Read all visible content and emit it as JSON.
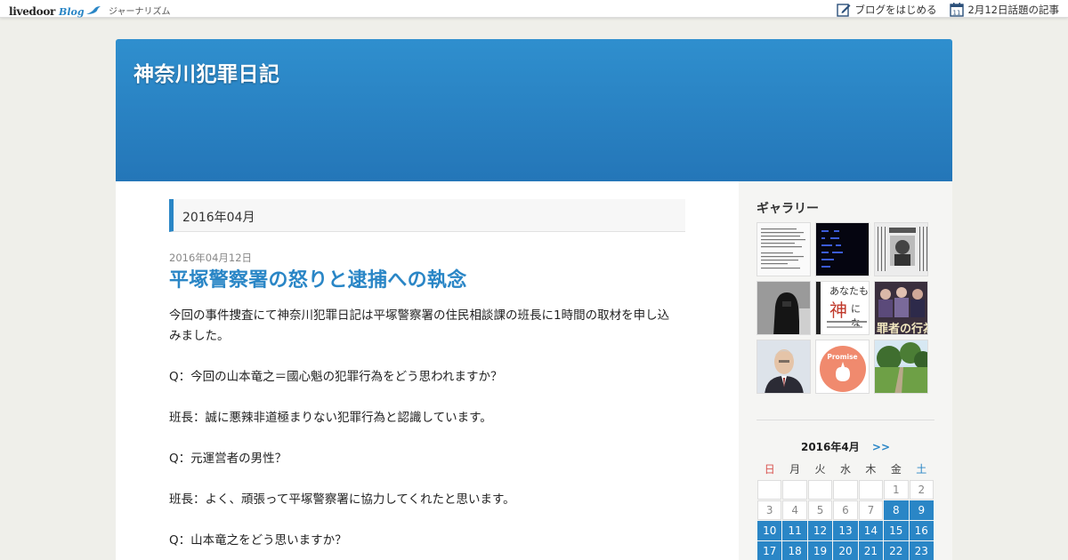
{
  "topbar": {
    "logo_main": "livedoor",
    "logo_blog": "Blog",
    "category": "ジャーナリズム",
    "start_blog": "ブログをはじめる",
    "topic_date_icon": "11",
    "topic_link": "2月12日話題の記事"
  },
  "header": {
    "site_title": "神奈川犯罪日記"
  },
  "archive": {
    "month_label": "2016年04月"
  },
  "post": {
    "date": "2016年04月12日",
    "title": "平塚警察署の怒りと逮捕への執念",
    "paragraphs": [
      "今回の事件捜査にて神奈川犯罪日記は平塚警察署の住民相談課の班長に1時間の取材を申し込みました。",
      "Q：今回の山本竜之＝國心魁の犯罪行為をどう思われますか？",
      "班長：誠に悪辣非道極まりない犯罪行為と認識しています。",
      "Q：元運営者の男性？",
      "班長：よく、頑張って平塚警察署に協力してくれたと思います。",
      "Q：山本竜之をどう思いますか？"
    ]
  },
  "sidebar": {
    "gallery_heading": "ギャラリー",
    "gallery": [
      {
        "name": "gallery-thumb-document",
        "alt": "document scan"
      },
      {
        "name": "gallery-thumb-dark-screen",
        "alt": "dark screen"
      },
      {
        "name": "gallery-thumb-newspaper",
        "alt": "newspaper clipping"
      },
      {
        "name": "gallery-thumb-hooded-figure",
        "alt": "hooded figure"
      },
      {
        "name": "gallery-thumb-kami-text",
        "alt": "text card",
        "text_top": "あなたも",
        "text_big": "神",
        "text_side": "にな"
      },
      {
        "name": "gallery-thumb-magazine",
        "alt": "magazine cover",
        "text": "罪者の行為"
      },
      {
        "name": "gallery-thumb-portrait",
        "alt": "portrait"
      },
      {
        "name": "gallery-thumb-promise",
        "alt": "promise illustration",
        "text": "Promise"
      },
      {
        "name": "gallery-thumb-park",
        "alt": "park path"
      }
    ],
    "calendar": {
      "title": "2016年4月",
      "next": ">>",
      "weekdays": [
        "日",
        "月",
        "火",
        "水",
        "木",
        "金",
        "土"
      ],
      "weeks": [
        [
          null,
          null,
          null,
          null,
          null,
          {
            "d": "1",
            "link": false
          },
          {
            "d": "2",
            "link": false
          }
        ],
        [
          {
            "d": "3",
            "link": false
          },
          {
            "d": "4",
            "link": false
          },
          {
            "d": "5",
            "link": false
          },
          {
            "d": "6",
            "link": false
          },
          {
            "d": "7",
            "link": false
          },
          {
            "d": "8",
            "link": true
          },
          {
            "d": "9",
            "link": true
          }
        ],
        [
          {
            "d": "10",
            "link": true
          },
          {
            "d": "11",
            "link": true
          },
          {
            "d": "12",
            "link": true
          },
          {
            "d": "13",
            "link": true
          },
          {
            "d": "14",
            "link": true
          },
          {
            "d": "15",
            "link": true
          },
          {
            "d": "16",
            "link": true
          }
        ],
        [
          {
            "d": "17",
            "link": true
          },
          {
            "d": "18",
            "link": true
          },
          {
            "d": "19",
            "link": true
          },
          {
            "d": "20",
            "link": true
          },
          {
            "d": "21",
            "link": true
          },
          {
            "d": "22",
            "link": true
          },
          {
            "d": "23",
            "link": true
          }
        ]
      ]
    }
  },
  "colors": {
    "accent": "#2a86c6",
    "header_top": "#2f8fce",
    "header_bottom": "#2476b8",
    "sunday": "#d9534f"
  }
}
